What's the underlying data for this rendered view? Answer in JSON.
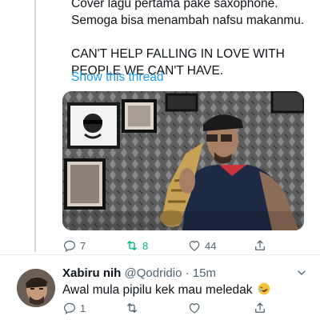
{
  "tweet": {
    "text_line1": "Cover lagu pertama pake saxophone.",
    "text_line2": "Semoga bisa menambah nafsu makanmu.",
    "text_line3": "CAN'T HELP FALLING IN LOVE WITH",
    "text_line4": "PEOPLE WE CAN'T HAVE.",
    "show_thread": "Show this thread",
    "media_alt": "Man playing saxophone in front of a patterned wall with framed pictures",
    "replies": "7",
    "retweets": "8",
    "likes": "44"
  },
  "reply": {
    "name": "Xabiru nih",
    "handle": "@Qodridio",
    "time": "· 15m",
    "text": "Awal mula pipilu kek mau meledak",
    "emoji": "rolling-on-floor-laughing-emoji",
    "replies": "1"
  },
  "colors": {
    "accent": "#1d9bf0",
    "retweet_green": "#00ba7c",
    "secondary_text": "#536471",
    "divider": "#e6ecf0"
  }
}
